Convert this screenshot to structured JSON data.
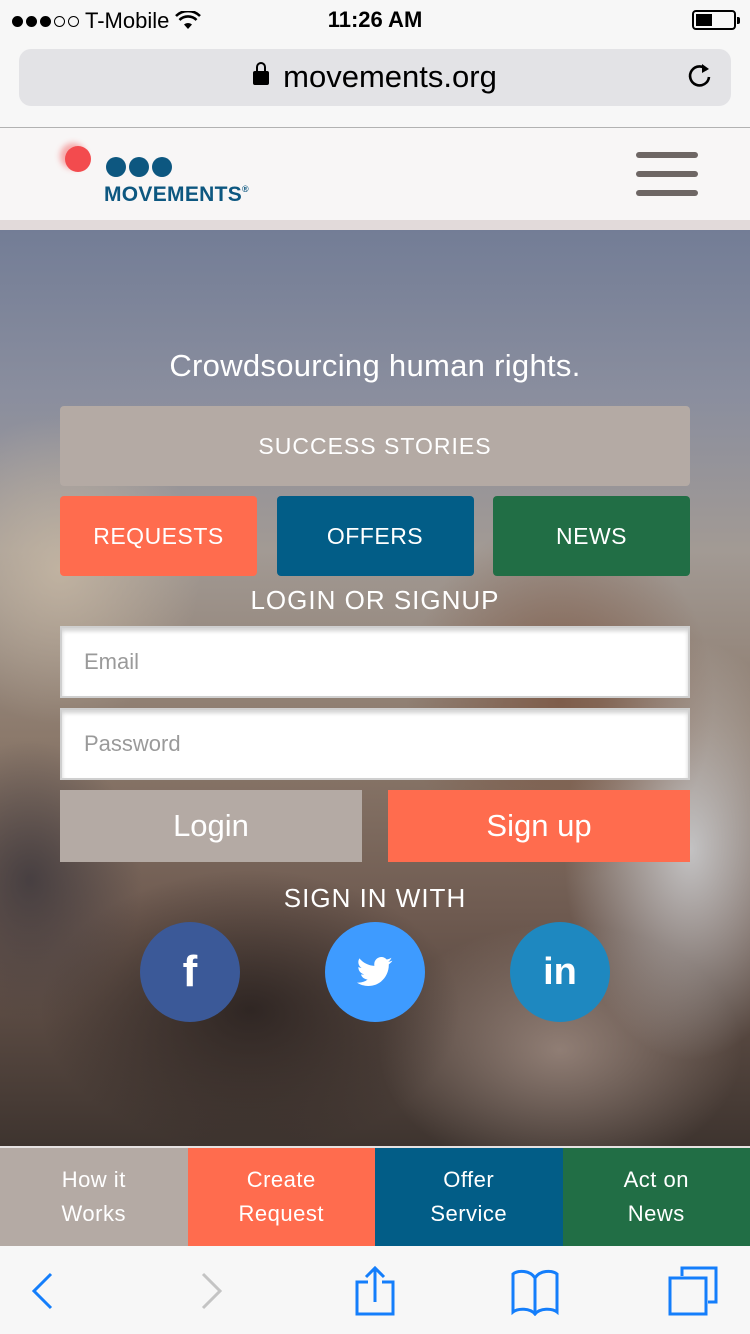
{
  "status_bar": {
    "carrier": "T-Mobile",
    "signal_bars_filled": 3,
    "signal_bars_total": 5,
    "time": "11:26 AM",
    "battery_level": 0.4
  },
  "browser": {
    "url": "movements.org",
    "secure": true
  },
  "header": {
    "logo_text": "MOVEMENTS",
    "logo_mark": "®"
  },
  "hero": {
    "tagline": "Crowdsourcing human rights.",
    "success_stories_label": "SUCCESS STORIES",
    "categories": [
      {
        "label": "REQUESTS",
        "color": "#ff6c4e"
      },
      {
        "label": "OFFERS",
        "color": "#025d87"
      },
      {
        "label": "NEWS",
        "color": "#216e45"
      }
    ],
    "login_heading": "LOGIN OR SIGNUP",
    "email_placeholder": "Email",
    "email_value": "",
    "password_placeholder": "Password",
    "password_value": "",
    "login_label": "Login",
    "signup_label": "Sign up",
    "signin_with_heading": "SIGN IN WITH",
    "social": [
      {
        "name": "facebook",
        "glyph": "f",
        "color": "#3b5998"
      },
      {
        "name": "twitter",
        "glyph": "",
        "color": "#3e9bff"
      },
      {
        "name": "linkedin",
        "glyph": "in",
        "color": "#1e88c0"
      }
    ]
  },
  "bottom_nav": [
    {
      "line1": "How it",
      "line2": "Works",
      "color": "#b4aaa4"
    },
    {
      "line1": "Create",
      "line2": "Request",
      "color": "#ff6c4e"
    },
    {
      "line1": "Offer",
      "line2": "Service",
      "color": "#025d87"
    },
    {
      "line1": "Act on",
      "line2": "News",
      "color": "#216e45"
    }
  ],
  "toolbar": {
    "icons": [
      "back-icon",
      "forward-icon",
      "share-icon",
      "bookmarks-icon",
      "tabs-icon"
    ],
    "accent": "#147efb",
    "disabled": "#c4c4c4"
  }
}
